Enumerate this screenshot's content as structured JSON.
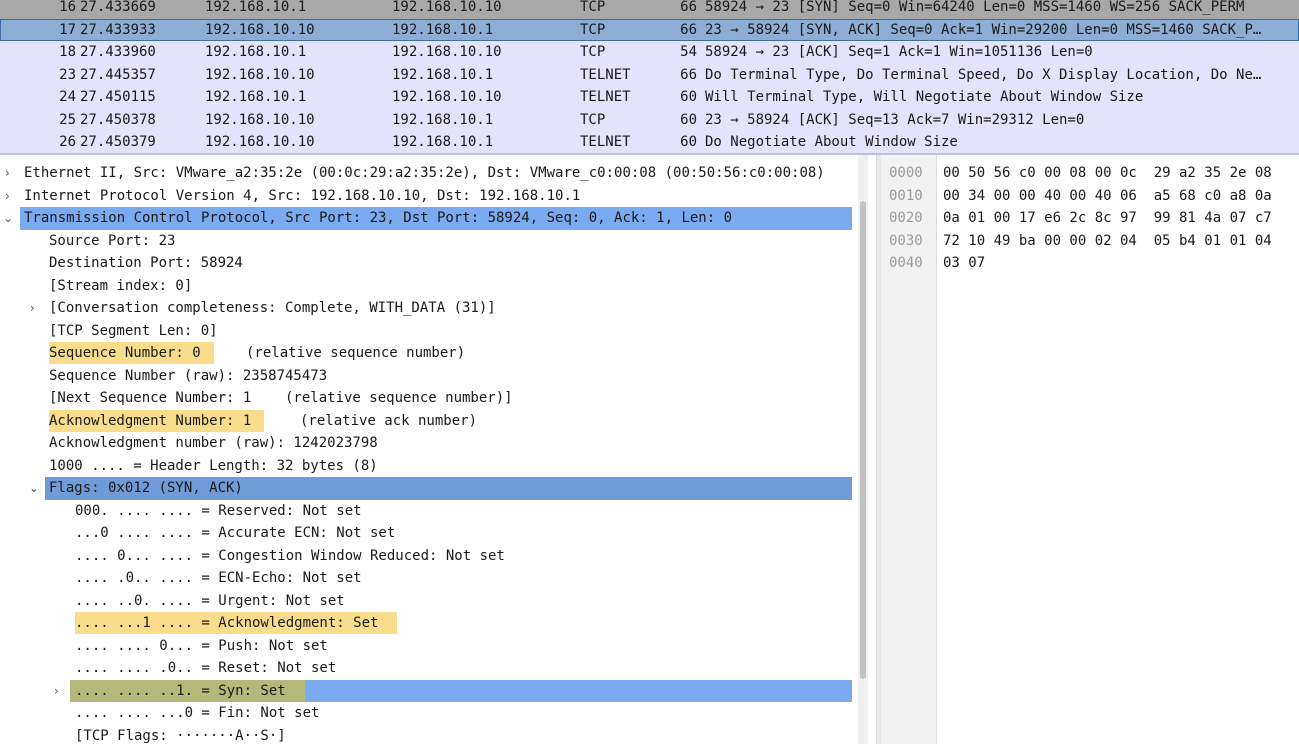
{
  "packets": [
    {
      "no": "16",
      "time": "27.433669",
      "src": "192.168.10.1",
      "dst": "192.168.10.10",
      "proto": "TCP",
      "len": "66",
      "info": "58924 → 23 [SYN] Seq=0 Win=64240 Len=0 MSS=1460 WS=256 SACK_PERM"
    },
    {
      "no": "17",
      "time": "27.433933",
      "src": "192.168.10.10",
      "dst": "192.168.10.1",
      "proto": "TCP",
      "len": "66",
      "info": "23 → 58924 [SYN, ACK] Seq=0 Ack=1 Win=29200 Len=0 MSS=1460 SACK_P…"
    },
    {
      "no": "18",
      "time": "27.433960",
      "src": "192.168.10.1",
      "dst": "192.168.10.10",
      "proto": "TCP",
      "len": "54",
      "info": "58924 → 23 [ACK] Seq=1 Ack=1 Win=1051136 Len=0"
    },
    {
      "no": "23",
      "time": "27.445357",
      "src": "192.168.10.10",
      "dst": "192.168.10.1",
      "proto": "TELNET",
      "len": "66",
      "info": "Do Terminal Type, Do Terminal Speed, Do X Display Location, Do Ne…"
    },
    {
      "no": "24",
      "time": "27.450115",
      "src": "192.168.10.1",
      "dst": "192.168.10.10",
      "proto": "TELNET",
      "len": "60",
      "info": "Will Terminal Type, Will Negotiate About Window Size"
    },
    {
      "no": "25",
      "time": "27.450378",
      "src": "192.168.10.10",
      "dst": "192.168.10.1",
      "proto": "TCP",
      "len": "60",
      "info": "23 → 58924 [ACK] Seq=13 Ack=7 Win=29312 Len=0"
    },
    {
      "no": "26",
      "time": "27.450379",
      "src": "192.168.10.10",
      "dst": "192.168.10.1",
      "proto": "TELNET",
      "len": "60",
      "info": "Do Negotiate About Window Size"
    }
  ],
  "details": [
    {
      "arrow": "›",
      "text": "Ethernet II, Src: VMware_a2:35:2e (00:0c:29:a2:35:2e), Dst: VMware_c0:00:08 (00:50:56:c0:00:08)"
    },
    {
      "arrow": "›",
      "text": "Internet Protocol Version 4, Src: 192.168.10.10, Dst: 192.168.10.1"
    },
    {
      "arrow": "⌄",
      "text": "Transmission Control Protocol, Src Port: 23, Dst Port: 58924, Seq: 0, Ack: 1, Len: 0"
    },
    {
      "text": "Source Port: 23"
    },
    {
      "text": "Destination Port: 58924"
    },
    {
      "text": "[Stream index: 0]"
    },
    {
      "arrow": "›",
      "text": "[Conversation completeness: Complete, WITH_DATA (31)]"
    },
    {
      "text": "[TCP Segment Len: 0]"
    },
    {
      "text": "Sequence Number: 0",
      "extra": "(relative sequence number)"
    },
    {
      "text": "Sequence Number (raw): 2358745473"
    },
    {
      "text": "[Next Sequence Number: 1    (relative sequence number)]"
    },
    {
      "text": "Acknowledgment Number: 1",
      "extra": "(relative ack number)"
    },
    {
      "text": "Acknowledgment number (raw): 1242023798"
    },
    {
      "text": "1000 .... = Header Length: 32 bytes (8)"
    },
    {
      "arrow": "⌄",
      "text": "Flags: 0x012 (SYN, ACK)"
    },
    {
      "text": "000. .... .... = Reserved: Not set"
    },
    {
      "text": "...0 .... .... = Accurate ECN: Not set"
    },
    {
      "text": ".... 0... .... = Congestion Window Reduced: Not set"
    },
    {
      "text": ".... .0.. .... = ECN-Echo: Not set"
    },
    {
      "text": ".... ..0. .... = Urgent: Not set"
    },
    {
      "text": ".... ...1 .... = Acknowledgment: Set"
    },
    {
      "text": ".... .... 0... = Push: Not set"
    },
    {
      "text": ".... .... .0.. = Reset: Not set"
    },
    {
      "arrow": "›",
      "text": ".... .... ..1. = Syn: Set"
    },
    {
      "text": ".... .... ...0 = Fin: Not set"
    },
    {
      "text": "[TCP Flags: ·······A··S·]"
    }
  ],
  "bytes": [
    {
      "offset": "0000",
      "hex": "00 50 56 c0 00 08 00 0c  29 a2 35 2e 08"
    },
    {
      "offset": "0010",
      "hex": "00 34 00 00 40 00 40 06  a5 68 c0 a8 0a"
    },
    {
      "offset": "0020",
      "hex": "0a 01 00 17 e6 2c 8c 97  99 81 4a 07 c7"
    },
    {
      "offset": "0030",
      "hex": "72 10 49 ba 00 00 02 04  05 b4 01 01 04"
    },
    {
      "offset": "0040",
      "hex": "03 07"
    }
  ]
}
